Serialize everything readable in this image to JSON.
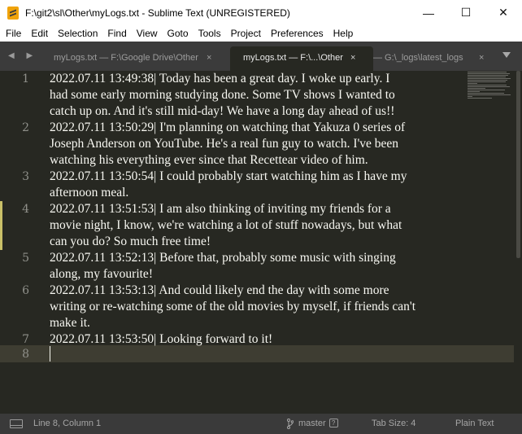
{
  "window": {
    "title": "F:\\git2\\sl\\Other\\myLogs.txt - Sublime Text (UNREGISTERED)",
    "minimize": "—",
    "maximize": "☐",
    "close": "✕"
  },
  "menu": [
    "File",
    "Edit",
    "Selection",
    "Find",
    "View",
    "Goto",
    "Tools",
    "Project",
    "Preferences",
    "Help"
  ],
  "tabs": [
    {
      "label": "myLogs.txt — F:\\Google Drive\\Other",
      "close": "×",
      "active": false
    },
    {
      "label": "myLogs.txt — F:\\...\\Other",
      "close": "×",
      "active": true
    },
    {
      "label": "— G:\\_logs\\latest_logs",
      "close": "×",
      "active": false
    }
  ],
  "tab_nav": "◀ ▶",
  "editor": {
    "lines": [
      {
        "number": "1",
        "text": [
          "2022.07.11 13:49:38| Today has been a great day. I woke up early. I",
          "had some early morning studying done. Some TV shows I wanted to",
          "catch up on. And it's still mid-day! We have a long day ahead of us!!"
        ]
      },
      {
        "number": "2",
        "text": [
          "2022.07.11 13:50:29| I'm planning on watching that Yakuza 0 series of",
          "Joseph Anderson on YouTube. He's a real fun guy to watch. I've been",
          "watching his everything ever since that Recettear video of him."
        ]
      },
      {
        "number": "3",
        "text": [
          "2022.07.11 13:50:54| I could probably start watching him as I have my",
          "afternoon meal."
        ]
      },
      {
        "number": "4",
        "text": [
          "2022.07.11 13:51:53| I am also thinking of inviting my friends for a",
          "movie night, I know, we're watching a lot of stuff nowadays, but what",
          "can you do? So much free time!"
        ]
      },
      {
        "number": "5",
        "text": [
          "2022.07.11 13:52:13| Before that, probably some music with singing",
          "along, my favourite!"
        ]
      },
      {
        "number": "6",
        "text": [
          "2022.07.11 13:53:13| And could likely end the day with some more",
          "writing or re-watching some of the old movies by myself, if friends can't",
          "make it."
        ]
      },
      {
        "number": "7",
        "text": [
          "2022.07.11 13:53:50| Looking forward to it!"
        ]
      },
      {
        "number": "8",
        "text": [
          ""
        ]
      }
    ]
  },
  "status": {
    "position": "Line 8, Column 1",
    "branch": "master",
    "branch_help": "?",
    "tab_size": "Tab Size: 4",
    "syntax": "Plain Text"
  },
  "colors": {
    "editor_bg": "#272822",
    "editor_fg": "#f8f8f2",
    "gutter_fg": "#8f908a",
    "tabbar_bg": "#3b3b3b",
    "statusbar_bg": "#3a3a3a",
    "modified_marker": "#e6db74",
    "accent_icon": "#f0a30a"
  }
}
